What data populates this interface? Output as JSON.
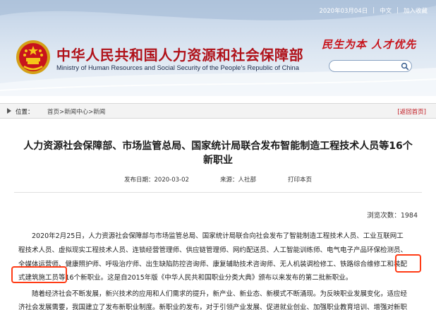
{
  "topbar": {
    "date": "2020年03月04日",
    "lang": "中文",
    "favorite": "加入收藏"
  },
  "site": {
    "title_cn": "中华人民共和国人力资源和社会保障部",
    "title_en": "Ministry of Human Resources and Social Security of the People's Republic of China",
    "slogan": "民生为本 人才优先"
  },
  "search": {
    "value": "",
    "placeholder": ""
  },
  "breadcrumb": {
    "label": "位置：",
    "home": "首页",
    "sep1": ">",
    "center": "新闻中心",
    "sep2": ">",
    "news": "新闻",
    "back": "[返回首页]"
  },
  "article": {
    "title_line1": "人力资源社会保障部、市场监管总局、国家统计局联合发布智能制造工程技术人员等16个",
    "title_line2": "新职业",
    "publish_label": "发布日期：",
    "publish_date": "2020-03-02",
    "source_label": "来源：",
    "source": "人社部",
    "print": "打印本页",
    "views_label": "浏览次数：",
    "views": "1984",
    "lines": [
      "　　2020年2月25日，人力资源社会保障部与市场监管总局、国家统计局联合向社会发布了智能制造工程技术人员、工业互联网工",
      "程技术人员、虚拟现实工程技术人员、连锁经营管理师、供应链管理师、网约配送员、人工智能训练师、电气电子产品环保检测员、",
      "全媒体运营师、健康照护师、呼吸治疗师、出生缺陷防控咨询师、康复辅助技术咨询师、无人机装调检修工、铁路综合维修工和装配",
      "式建筑施工员等16个新职业。这是自2015年版《中华人民共和国职业分类大典》颁布以来发布的第二批新职业。",
      "　　随着经济社会不断发展，新兴技术的应用和人们需求的提升，新产业、新业态、新模式不断涌现。为反映职业发展变化，适应经",
      "济社会发展需要，我国建立了发布新职业制度。新职业的发布，对于引领产业发展、促进就业创业、加强职业教育培训、增强对新职"
    ]
  },
  "colors": {
    "accent_red": "#b0121a",
    "highlight": "#ff3b15",
    "header_blue": "#c9d8ea"
  }
}
